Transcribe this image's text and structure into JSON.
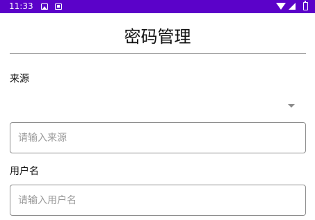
{
  "status_bar": {
    "time": "11:33",
    "notification_icons": [
      "image-icon",
      "a-icon"
    ],
    "status_icons": [
      "wifi-icon",
      "signal-icon",
      "battery-icon"
    ],
    "background_color": "#5b02c9"
  },
  "header": {
    "title": "密码管理"
  },
  "form": {
    "source_label": "来源",
    "source_spinner_value": "",
    "source_input": {
      "value": "",
      "placeholder": "请输入来源"
    },
    "username_label": "用户名",
    "username_input": {
      "value": "",
      "placeholder": "请输入用户名"
    }
  }
}
